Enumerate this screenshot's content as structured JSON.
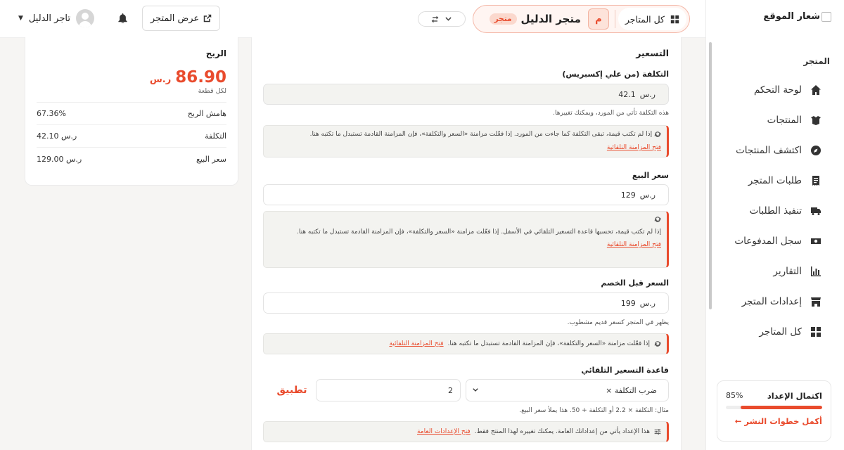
{
  "sidebar": {
    "logo": "شعار الموقع",
    "section": "المتجر",
    "items": [
      {
        "label": "لوحة التحكم",
        "icon": "home-icon"
      },
      {
        "label": "المنتجات",
        "icon": "box-open-icon"
      },
      {
        "label": "اكتشف المنتجات",
        "icon": "compass-icon"
      },
      {
        "label": "طلبات المتجر",
        "icon": "receipt-icon"
      },
      {
        "label": "تنفيذ الطلبات",
        "icon": "truck-icon"
      },
      {
        "label": "سجل المدفوعات",
        "icon": "money-icon"
      },
      {
        "label": "التقارير",
        "icon": "chart-bar-icon"
      },
      {
        "label": "إعدادات المتجر",
        "icon": "store-icon"
      },
      {
        "label": "كل المتاجر",
        "icon": "grid-icon"
      }
    ],
    "setup": {
      "title": "اكتمال الإعداد",
      "percent_text": "85%",
      "progress": 0.85,
      "link": "أكمل خطوات النشر ←"
    }
  },
  "header": {
    "all_stores": "كل المتاجر",
    "store_avatar": "م",
    "store_name": "متجر الدليل",
    "store_badge": "متجر",
    "view_store": "عرض المتجر",
    "user_name": "تاجر الدليل"
  },
  "profit": {
    "title": "الربح",
    "amount": "86.90",
    "currency": "ر.س",
    "per_unit": "لكل قطعة",
    "rows": [
      {
        "label": "هامش الربح",
        "value": "67.36%"
      },
      {
        "label": "التكلفة",
        "value": "42.10 ر.س"
      },
      {
        "label": "سعر البيع",
        "value": "129.00 ر.س"
      }
    ]
  },
  "pricing": {
    "title": "التسعير",
    "cost_label": "التكلفة (من علي إكسبريس)",
    "cost_currency": "ر.س",
    "cost_value": "42.1",
    "cost_hint": "هذه التكلفة تأتي من المورد، ويمكنك تغييرها.",
    "cost_note": "إذا لم تكتب قيمة، تبقى التكلفة كما جاءت من المورد. إذا فعّلت مزامنة «السعر والتكلفة»، فإن المزامنة القادمة تستبدل ما تكتبه هنا.",
    "sync_link": "فتح المزامنة التلقائية",
    "price_label": "سعر البيع",
    "price_currency": "ر.س",
    "price_value": "129",
    "price_note": "إذا لم تكتب قيمة، تحسبها قاعدة التسعير التلقائي في الأسفل. إذا فعّلت مزامنة «السعر والتكلفة»، فإن المزامنة القادمة تستبدل ما تكتبه هنا.",
    "compare_label": "السعر قبل الخصم",
    "compare_currency": "ر.س",
    "compare_value": "199",
    "compare_hint": "يظهر في المتجر كسعر قديم مشطوب.",
    "compare_note": "إذا فعّلت مزامنة «السعر والتكلفة»، فإن المزامنة القادمة تستبدل ما تكتبه هنا.",
    "rule_label": "قاعدة التسعير التلقائي",
    "rule_option": "ضرب التكلفة ×",
    "rule_value": "2",
    "apply": "تطبيق",
    "rule_hint": "مثال: التكلفة × 2.2 أو التكلفة + 50. هذا يملأ سعر البيع.",
    "global_note": "هذا الإعداد يأتي من إعداداتك العامة. يمكنك تغييره لهذا المنتج فقط.",
    "global_link": "فتح الإعدادات العامة"
  }
}
